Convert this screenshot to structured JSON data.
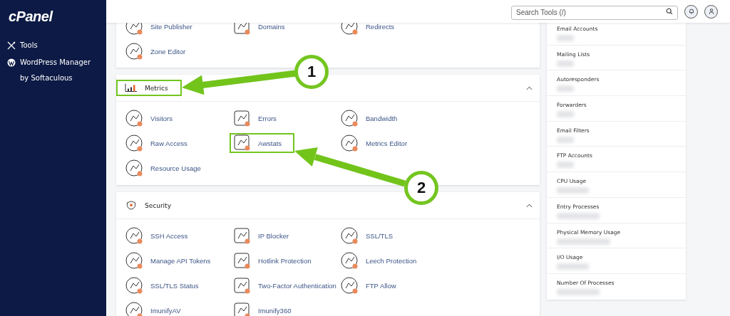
{
  "sidebar": {
    "logo": "cPanel",
    "items": [
      {
        "label": "Tools",
        "kind": "tools"
      },
      {
        "label": "WordPress Manager by Softaculous",
        "kind": "wordpress"
      }
    ]
  },
  "header": {
    "search": {
      "placeholder": "Search Tools (/)"
    }
  },
  "sections": [
    {
      "items": [
        {
          "label": "Site Publisher",
          "highlighted": false
        },
        {
          "label": "Domains",
          "highlighted": false
        },
        {
          "label": "Redirects",
          "highlighted": false
        },
        {
          "label": "Zone Editor",
          "highlighted": false
        }
      ]
    },
    {
      "title": "Metrics",
      "expanded": true,
      "highlighted": true,
      "items": [
        {
          "label": "Visitors",
          "highlighted": false
        },
        {
          "label": "Errors",
          "highlighted": false
        },
        {
          "label": "Bandwidth",
          "highlighted": false
        },
        {
          "label": "Raw Access",
          "highlighted": false
        },
        {
          "label": "Awstats",
          "highlighted": true
        },
        {
          "label": "Metrics Editor",
          "highlighted": false
        },
        {
          "label": "Resource Usage",
          "highlighted": false
        }
      ]
    },
    {
      "title": "Security",
      "expanded": true,
      "highlighted": false,
      "items": [
        {
          "label": "SSH Access",
          "highlighted": false
        },
        {
          "label": "IP Blocker",
          "highlighted": false
        },
        {
          "label": "SSL/TLS",
          "highlighted": false
        },
        {
          "label": "Manage API Tokens",
          "highlighted": false
        },
        {
          "label": "Hotlink Protection",
          "highlighted": false
        },
        {
          "label": "Leech Protection",
          "highlighted": false
        },
        {
          "label": "SSL/TLS Status",
          "highlighted": false
        },
        {
          "label": "Two-Factor Authentication",
          "highlighted": false
        },
        {
          "label": "FTP Allow",
          "highlighted": false
        },
        {
          "label": "ImunifyAV",
          "highlighted": false
        },
        {
          "label": "Imunify360",
          "highlighted": false
        }
      ]
    }
  ],
  "stats": [
    {
      "label": "Email Accounts"
    },
    {
      "label": "Mailing Lists"
    },
    {
      "label": "Autoresponders"
    },
    {
      "label": "Forwarders"
    },
    {
      "label": "Email Filters"
    },
    {
      "label": "FTP Accounts"
    },
    {
      "label": "CPU Usage"
    },
    {
      "label": "Entry Processes"
    },
    {
      "label": "Physical Memory Usage"
    },
    {
      "label": "I/O Usage"
    },
    {
      "label": "Number Of Processes"
    }
  ],
  "annotations": [
    {
      "label": "1"
    },
    {
      "label": "2"
    }
  ]
}
